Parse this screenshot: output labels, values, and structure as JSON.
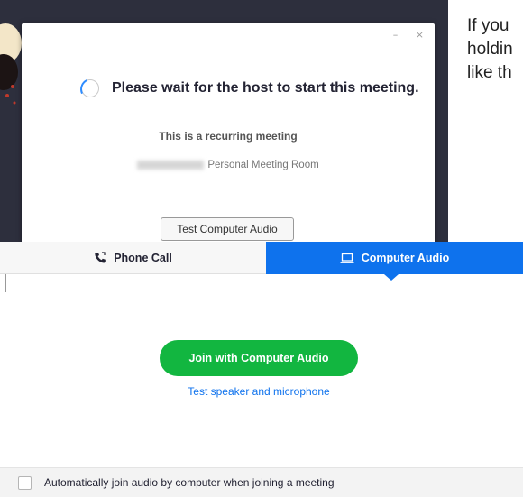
{
  "waiting_dialog": {
    "wait_message": "Please wait for the host to start this meeting.",
    "recurring_label": "This is a recurring meeting",
    "room_label": "Personal Meeting Room",
    "test_audio_button": "Test Computer Audio"
  },
  "side_text": [
    "If you",
    "holdin",
    "like th"
  ],
  "audio_tabs": {
    "phone_call": "Phone Call",
    "computer_audio": "Computer Audio",
    "active": "Computer Audio"
  },
  "join_button": "Join with Computer Audio",
  "test_link": "Test speaker and microphone",
  "auto_join": {
    "label": "Automatically join audio by computer when joining a meeting",
    "checked": false
  },
  "colors": {
    "accent_blue": "#0e72ed",
    "join_green": "#12b640",
    "dark_bg": "#2d2f3d"
  },
  "icons": [
    "spinner-icon",
    "phone-icon",
    "laptop-icon",
    "minimize-icon",
    "close-icon"
  ]
}
